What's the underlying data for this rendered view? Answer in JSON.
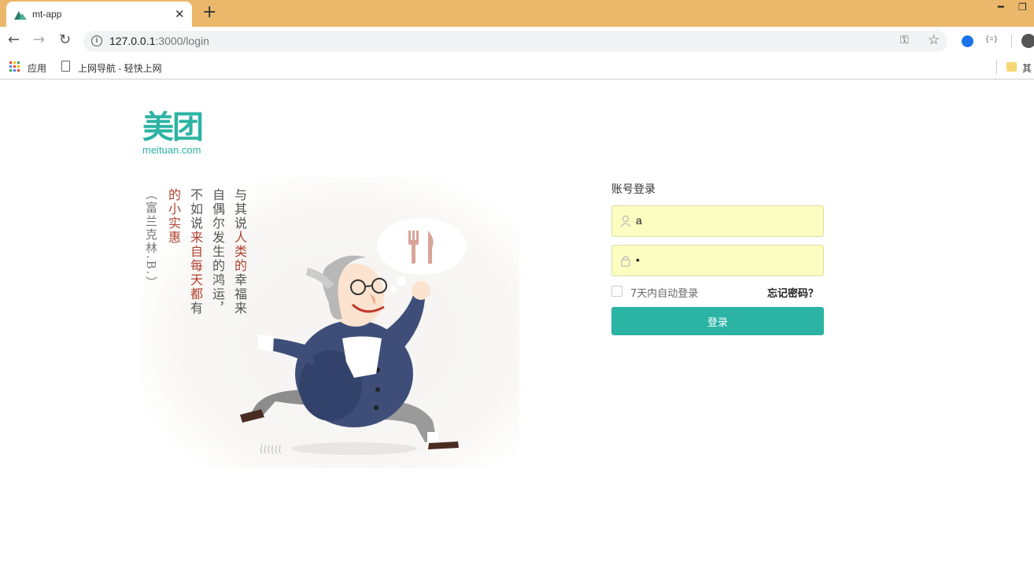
{
  "browser": {
    "tab_title": "mt-app",
    "tab_close": "✕",
    "new_tab": "+",
    "url_host": "127.0.0.1",
    "url_path": ":3000/login",
    "bookmarks": [
      {
        "label": "应用"
      },
      {
        "label": "上网导航 - 轻快上网"
      },
      {
        "label": "其"
      }
    ],
    "extension_label": "{=}"
  },
  "logo": {
    "cn": "美团",
    "en": "meituan.com"
  },
  "illustration": {
    "quote_columns": [
      {
        "text": "与其说",
        "emph": "人类的",
        "rest": "幸福来"
      },
      {
        "text": "自偶尔发生的鸿运，"
      },
      {
        "text": "不如说",
        "emph": "来自每天都",
        "rest": "有"
      },
      {
        "emph": "的小实惠"
      }
    ],
    "author": "（富兰克林.B.）"
  },
  "login": {
    "title": "账号登录",
    "username_value": "a",
    "password_value": "•",
    "remember_label": "7天内自动登录",
    "forgot_label": "忘记密码？",
    "submit_label": "登录"
  },
  "colors": {
    "brand": "#2bb3a3",
    "autofill": "#fbfdc1",
    "chrome_bar": "#ebb86b",
    "accent_text": "#b0422f"
  },
  "icons": [
    "mountain-favicon",
    "back-icon",
    "forward-icon",
    "reload-icon",
    "info-icon",
    "key-icon",
    "star-icon",
    "apps-icon",
    "page-icon",
    "folder-icon",
    "user-icon",
    "lock-icon",
    "fork-knife-icon"
  ]
}
